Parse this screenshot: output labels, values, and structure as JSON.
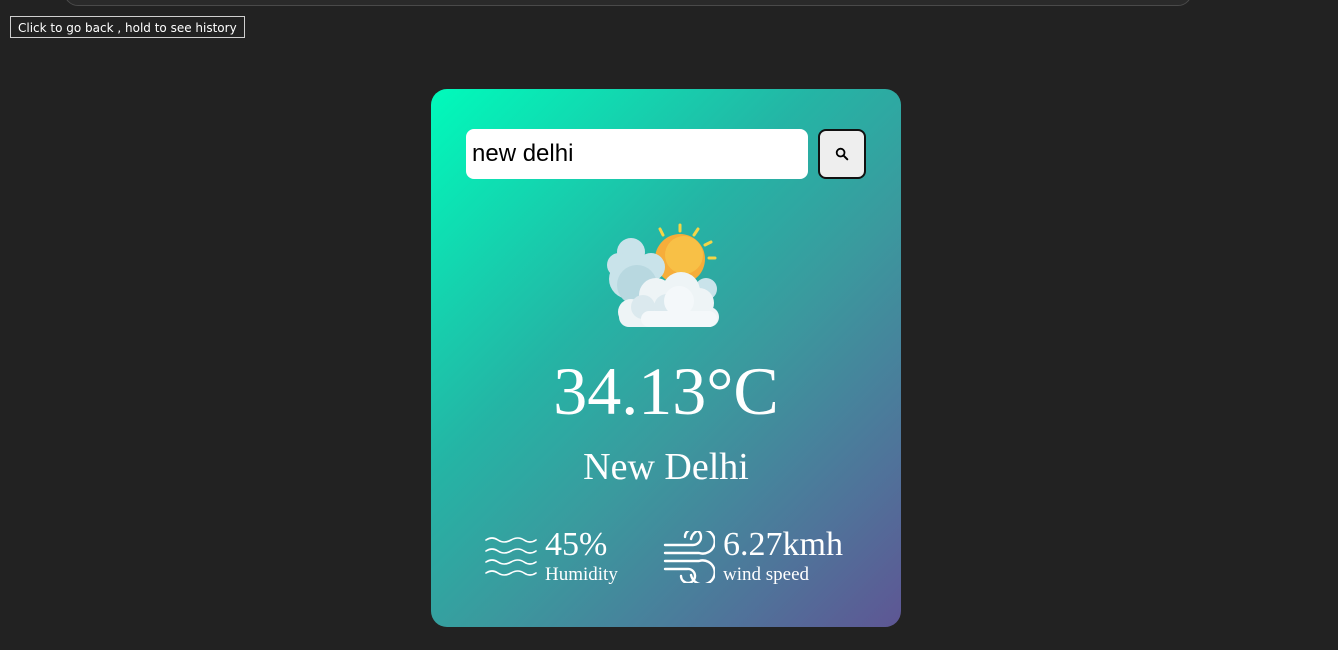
{
  "tooltip": {
    "text": "Click to go back , hold to see history"
  },
  "search": {
    "value": "new delhi",
    "button_icon": "search-icon"
  },
  "weather": {
    "condition_icon": "sun-behind-clouds-icon",
    "temperature": "34.13°C",
    "city": "New Delhi"
  },
  "details": {
    "humidity": {
      "value": "45%",
      "label": "Humidity",
      "icon": "humidity-waves-icon"
    },
    "wind": {
      "value": "6.27kmh",
      "label": "wind speed",
      "icon": "wind-icon"
    }
  },
  "colors": {
    "page_background": "#222222",
    "card_gradient_start": "#00fbbb",
    "card_gradient_end": "#5e5694",
    "text": "#ffffff"
  }
}
